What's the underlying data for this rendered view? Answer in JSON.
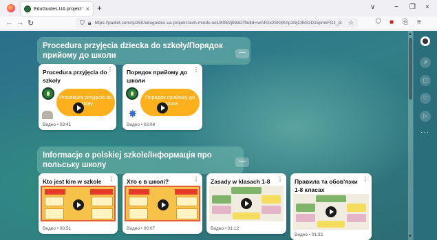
{
  "browser": {
    "tab_title": "EduGuides.UA projekt Tech Mi",
    "tab_close": "×",
    "new_tab": "+",
    "url": "https://padlet.com/sp350/eduguides-ua-projekt-tech-minds-oo19t0l8zj99a97fbdld=lwAR2x2SK8Khp1NjC8kSzD15pmkFOz_j3",
    "window_controls": [
      "∨",
      "−",
      "❐",
      "×"
    ]
  },
  "sections": [
    {
      "title": "Procedura przyjęcia dziecka do szkoły/Порядок прийому до школи",
      "collapse_label": "—",
      "cards": [
        {
          "title": "Procedura przyjęcia do szkoły",
          "thumb_text": "Procedura przyjęcia do szkoły",
          "meta": "Видео • 03:41"
        },
        {
          "title": "Порядок прийому до школи",
          "thumb_text": "Порядок прийому до школи",
          "meta": "Видео • 03:08"
        }
      ]
    },
    {
      "title": "Informacje o polskiej szkole/Інформація про польську школу",
      "collapse_label": "—",
      "cards": [
        {
          "title": "Kto jest kim w szkole",
          "meta": "Видео • 00:51"
        },
        {
          "title": "Хто є в школі?",
          "meta": "Видео • 00:07"
        },
        {
          "title": "Zasady w klasach 1-8",
          "meta": "Видео • 01:12"
        },
        {
          "title": "Правила та обов'язки 1-8 класах",
          "meta": "Видео • 01:32"
        }
      ]
    }
  ],
  "icons": {
    "more": "⋮",
    "star": "✸",
    "rail": [
      "⇗",
      "▢",
      "♡",
      "▷"
    ],
    "rail_more": "···"
  },
  "colors": {
    "brand_orange": "#fbb01c",
    "canvas_teal": "#317f88"
  }
}
